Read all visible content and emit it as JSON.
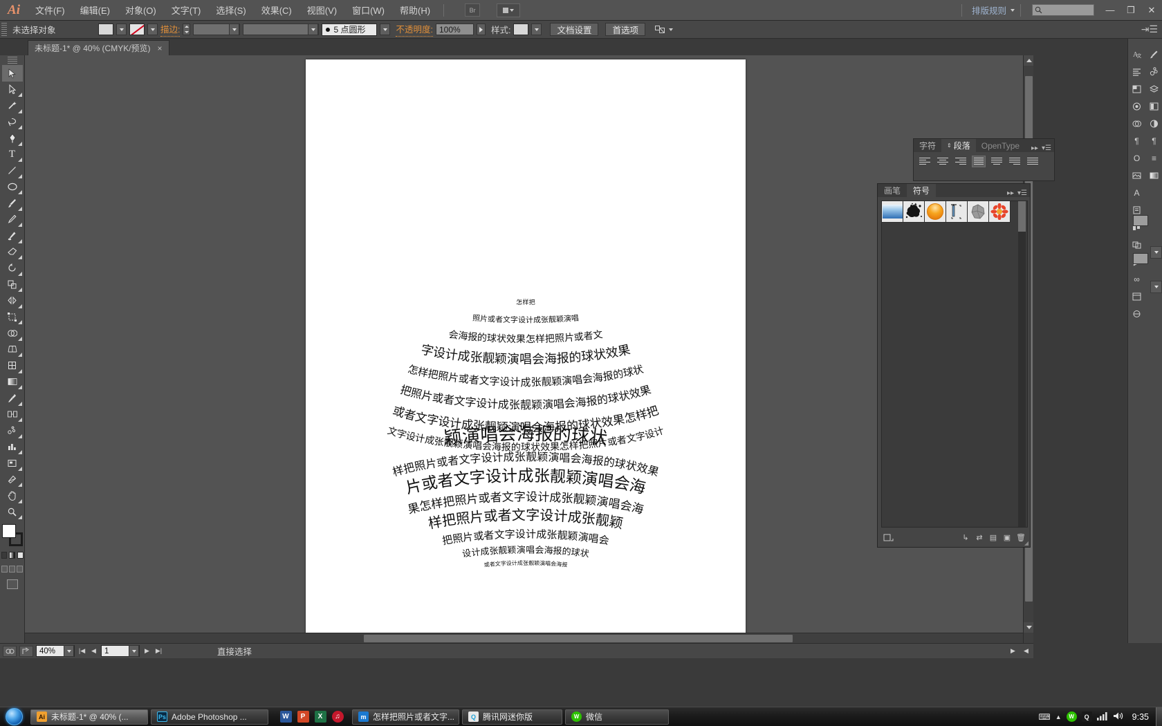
{
  "app": {
    "logo": "Ai",
    "menus": [
      "文件(F)",
      "编辑(E)",
      "对象(O)",
      "文字(T)",
      "选择(S)",
      "效果(C)",
      "视图(V)",
      "窗口(W)",
      "帮助(H)"
    ],
    "bridge_button": "Br",
    "workspace": "排版规则",
    "search_placeholder": "",
    "window_buttons": {
      "minimize": "—",
      "maximize": "❐",
      "close": "✕"
    }
  },
  "control_bar": {
    "selection_status": "未选择对象",
    "stroke_label": "描边:",
    "stroke_weight": "",
    "profile_value": "5 点圆形",
    "opacity_label": "不透明度:",
    "opacity_value": "100%",
    "style_label": "样式:",
    "document_setup": "文档设置",
    "preferences": "首选项"
  },
  "document_tab": {
    "title": "未标题-1* @ 40% (CMYK/预览)",
    "close": "×"
  },
  "toolbar": {
    "tools": [
      {
        "name": "selection-tool",
        "glyph": "▶"
      },
      {
        "name": "direct-selection-tool",
        "glyph": "▷"
      },
      {
        "name": "magic-wand-tool",
        "glyph": "✦"
      },
      {
        "name": "lasso-tool",
        "glyph": "◠"
      },
      {
        "name": "pen-tool",
        "glyph": "✒"
      },
      {
        "name": "type-tool",
        "glyph": "T"
      },
      {
        "name": "line-segment-tool",
        "glyph": "╱"
      },
      {
        "name": "ellipse-tool",
        "glyph": "◯"
      },
      {
        "name": "paintbrush-tool",
        "glyph": "🖌"
      },
      {
        "name": "pencil-tool",
        "glyph": "✎"
      },
      {
        "name": "blob-brush-tool",
        "glyph": "✏"
      },
      {
        "name": "eraser-tool",
        "glyph": "▱"
      },
      {
        "name": "rotate-tool",
        "glyph": "↻"
      },
      {
        "name": "scale-tool",
        "glyph": "⤢"
      },
      {
        "name": "width-tool",
        "glyph": "⋈"
      },
      {
        "name": "free-transform-tool",
        "glyph": "⬚"
      },
      {
        "name": "shape-builder-tool",
        "glyph": "◑"
      },
      {
        "name": "perspective-grid-tool",
        "glyph": "⌗"
      },
      {
        "name": "mesh-tool",
        "glyph": "⊞"
      },
      {
        "name": "gradient-tool",
        "glyph": "▤"
      },
      {
        "name": "eyedropper-tool",
        "glyph": "✦"
      },
      {
        "name": "blend-tool",
        "glyph": "⧉"
      },
      {
        "name": "symbol-sprayer-tool",
        "glyph": "❂"
      },
      {
        "name": "column-graph-tool",
        "glyph": "▥"
      },
      {
        "name": "artboard-tool",
        "glyph": "▣"
      },
      {
        "name": "slice-tool",
        "glyph": "✂"
      },
      {
        "name": "hand-tool",
        "glyph": "✋"
      },
      {
        "name": "zoom-tool",
        "glyph": "🔍"
      }
    ],
    "screen_mode": "screen-mode"
  },
  "character_panel": {
    "tabs": [
      "字符",
      "段落",
      "OpenType"
    ],
    "active_tab": "段落",
    "align_buttons": [
      "align-left",
      "align-center",
      "align-right",
      "justify-last-left",
      "justify-last-center",
      "justify-last-right",
      "justify-all"
    ],
    "active_align_index": 3
  },
  "symbol_panel": {
    "tabs": [
      "画笔",
      "符号"
    ],
    "active_tab": "符号",
    "symbols": [
      {
        "name": "sky-gradient-symbol",
        "type": "gradient-blue"
      },
      {
        "name": "ink-splat-symbol",
        "type": "splat"
      },
      {
        "name": "orange-sphere-symbol",
        "type": "orb-orange"
      },
      {
        "name": "ruler-tool-symbol",
        "type": "ruler"
      },
      {
        "name": "gray-rock-symbol",
        "type": "rock"
      },
      {
        "name": "red-flower-symbol",
        "type": "flower"
      }
    ]
  },
  "status_bar": {
    "zoom": "40%",
    "page": "1",
    "current_tool": "直接选择"
  },
  "artwork": {
    "phrase": "怎样把照片或者文字设计成张靓颖演唱会海报的球状效果",
    "description": "spherical-text-warp"
  },
  "taskbar": {
    "tasks": [
      {
        "label": "未标题-1* @ 40% (...",
        "icon": "Ai",
        "icon_color": "#e08a2e",
        "active": true
      },
      {
        "label": "Adobe Photoshop ...",
        "icon": "Ps",
        "icon_color": "#2aa3dd",
        "active": false
      }
    ],
    "quick_icons": [
      {
        "name": "word-icon",
        "glyph": "W",
        "color": "#2b579a"
      },
      {
        "name": "powerpoint-icon",
        "glyph": "P",
        "color": "#d24726"
      },
      {
        "name": "excel-icon",
        "glyph": "X",
        "color": "#1e7145"
      },
      {
        "name": "kugou-icon",
        "glyph": "♫",
        "color": "#c4182c"
      }
    ],
    "more_tasks": [
      {
        "label": "怎样把照片或者文字...",
        "icon": "m",
        "icon_color": "#1b79d0"
      },
      {
        "label": "腾讯网迷你版",
        "icon": "Q",
        "icon_color": "#1fa3d8"
      },
      {
        "label": "微信",
        "icon": "W",
        "icon_color": "#2dc100"
      }
    ],
    "tray": {
      "keyboard_icon": "⌨",
      "expand_icon": "▲",
      "wechat_icon": "W",
      "qq_icon": "Q",
      "network_icon": "▮",
      "volume_icon": "🔊",
      "clock": "9:35"
    }
  },
  "colors": {
    "chrome": "#535353",
    "panel": "#454545",
    "canvas": "#535353",
    "accent_orange": "#e08f3a",
    "text": "#d4d4d4"
  }
}
